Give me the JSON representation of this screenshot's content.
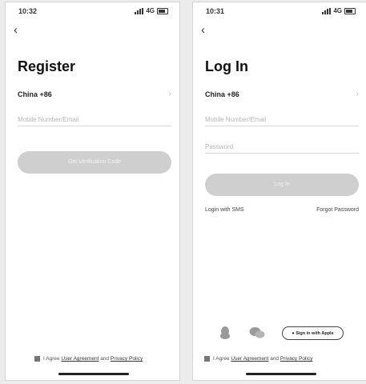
{
  "register": {
    "status_time": "10:32",
    "signal_text": "4G",
    "title": "Register",
    "country": "China +86",
    "phone_placeholder": "Mobile Number/Email",
    "get_code_label": "Get Verification Code",
    "agree_prefix": "I Agree",
    "user_agreement": "User Agreement",
    "and_text": "and",
    "privacy_policy": "Privacy Policy"
  },
  "login": {
    "status_time": "10:31",
    "signal_text": "4G",
    "title": "Log In",
    "country": "China +86",
    "phone_placeholder": "Mobile Number/Email",
    "password_placeholder": "Password",
    "login_label": "Log In",
    "sms_login": "Login with SMS",
    "forgot_password": "Forgot Password",
    "apple_signin": "Sign in with Apple",
    "agree_prefix": "I Agree",
    "user_agreement": "User Agreement",
    "and_text": "and",
    "privacy_policy": "Privacy Policy"
  }
}
